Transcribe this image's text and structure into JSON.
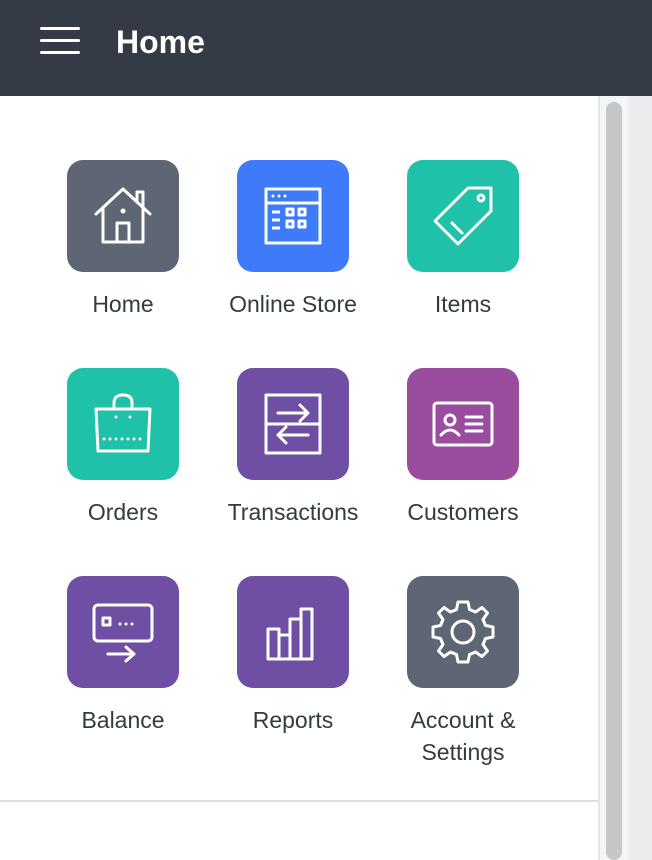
{
  "header": {
    "title": "Home",
    "bg_color": "#343b45"
  },
  "tiles": [
    {
      "label": "Home",
      "icon": "house-icon",
      "color": "#5e6674"
    },
    {
      "label": "Online Store",
      "icon": "online-store-icon",
      "color": "#3e7bfa"
    },
    {
      "label": "Items",
      "icon": "tag-icon",
      "color": "#1fc1a9"
    },
    {
      "label": "Orders",
      "icon": "shopping-bag-icon",
      "color": "#1fc1a9"
    },
    {
      "label": "Transactions",
      "icon": "transfer-arrows-icon",
      "color": "#6e4fa3"
    },
    {
      "label": "Customers",
      "icon": "id-card-icon",
      "color": "#9a4c9e"
    },
    {
      "label": "Balance",
      "icon": "card-transfer-icon",
      "color": "#6e4fa3"
    },
    {
      "label": "Reports",
      "icon": "bar-chart-icon",
      "color": "#6e4fa3"
    },
    {
      "label": "Account &\nSettings",
      "icon": "gear-icon",
      "color": "#5e6674"
    }
  ]
}
